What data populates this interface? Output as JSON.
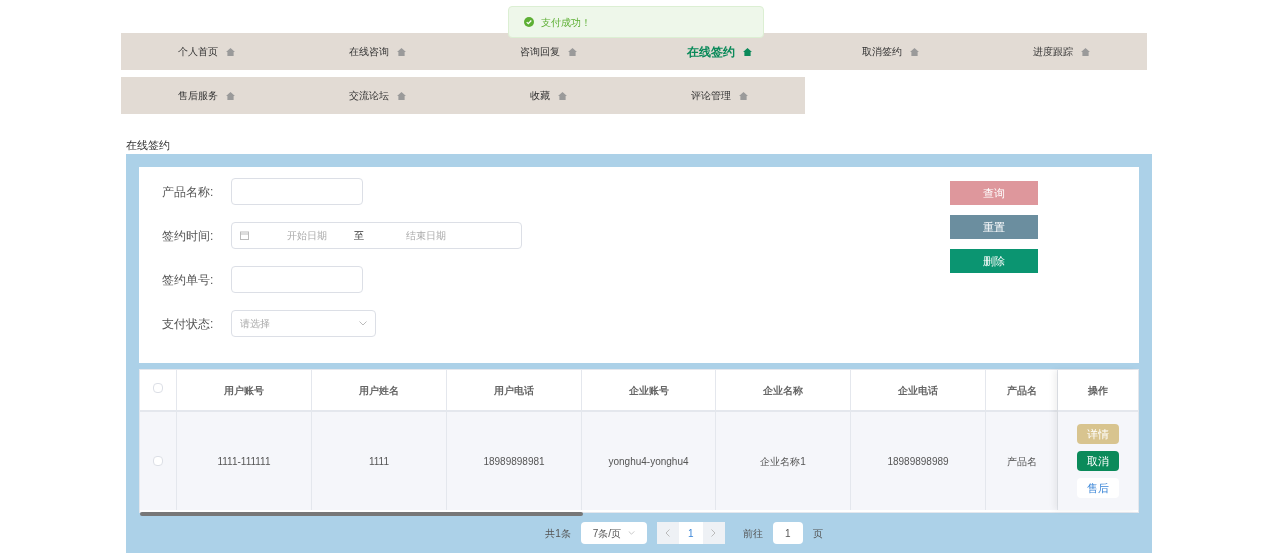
{
  "toast": {
    "message": "支付成功！"
  },
  "nav_rows": [
    [
      {
        "label": "个人首页",
        "selected": false
      },
      {
        "label": "在线咨询",
        "selected": false
      },
      {
        "label": "咨询回复",
        "selected": false
      },
      {
        "label": "在线签约",
        "selected": true
      },
      {
        "label": "取消签约",
        "selected": false
      },
      {
        "label": "进度跟踪",
        "selected": false
      }
    ],
    [
      {
        "label": "售后服务",
        "selected": false
      },
      {
        "label": "交流论坛",
        "selected": false
      },
      {
        "label": "收藏",
        "selected": false
      },
      {
        "label": "评论管理",
        "selected": false
      }
    ]
  ],
  "page_title": "在线签约",
  "filters": [
    {
      "kind": "text",
      "label": "产品名称:"
    },
    {
      "kind": "daterange",
      "label": "签约时间:",
      "start_placeholder": "开始日期",
      "separator": "至",
      "end_placeholder": "结束日期"
    },
    {
      "kind": "text",
      "label": "签约单号:"
    },
    {
      "kind": "select",
      "label": "支付状态:",
      "placeholder": "请选择"
    }
  ],
  "actions": [
    {
      "kind": "search",
      "label": "查询"
    },
    {
      "kind": "reset",
      "label": "重置"
    },
    {
      "kind": "delete",
      "label": "删除"
    }
  ],
  "table": {
    "all_checked": false,
    "columns": [
      "用户账号",
      "用户姓名",
      "用户电话",
      "企业账号",
      "企业名称",
      "企业电话",
      "产品名"
    ],
    "action_column": "操作",
    "rows": [
      {
        "checked": false,
        "cells": [
          "1111-111111",
          "1111",
          "18989898981",
          "yonghu4-yonghu4",
          "企业名称1",
          "18989898989",
          "产品名"
        ],
        "actions": [
          {
            "kind": "detail",
            "label": "详情"
          },
          {
            "kind": "cancel",
            "label": "取消"
          },
          {
            "kind": "aftersale",
            "label": "售后"
          }
        ]
      }
    ]
  },
  "pagination": {
    "total": "共1条",
    "page_size": "7条/页",
    "current_page": "1",
    "goto_label": "前往",
    "goto_value": "1",
    "page_suffix": "页"
  }
}
